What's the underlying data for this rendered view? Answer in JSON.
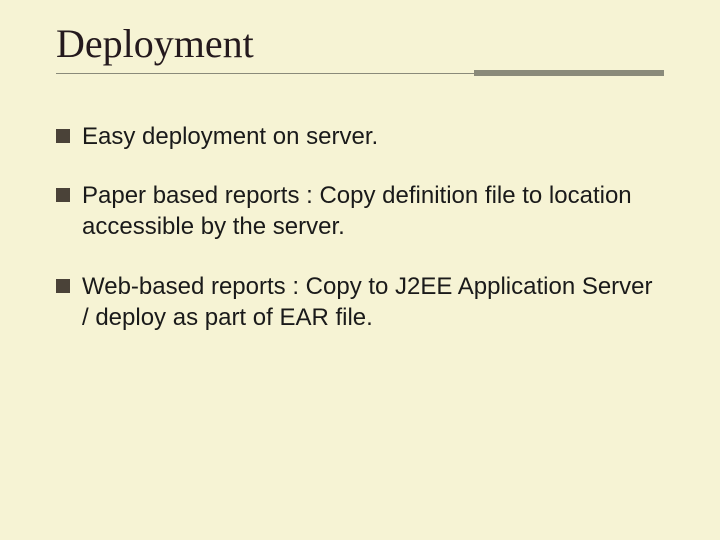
{
  "slide": {
    "title": "Deployment",
    "bullets": [
      "Easy deployment on server.",
      "Paper based reports : Copy definition file to location accessible by the server.",
      "Web-based reports : Copy to J2EE Application Server / deploy as part of EAR file."
    ]
  }
}
